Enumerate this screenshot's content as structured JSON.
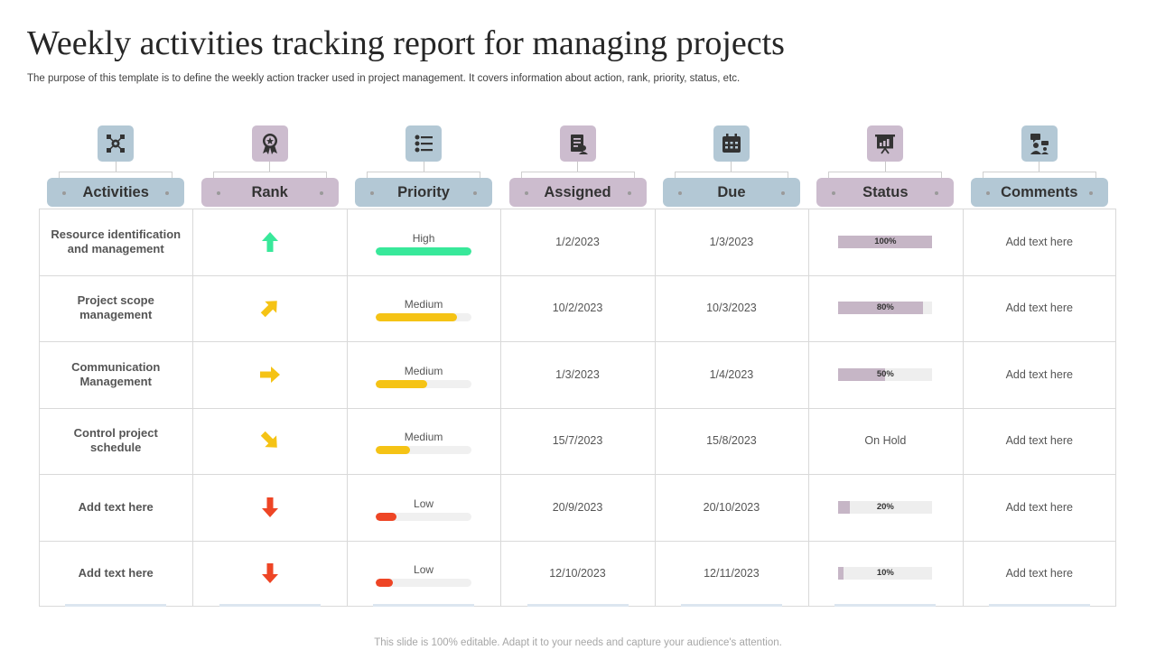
{
  "title": "Weekly activities tracking report for managing projects",
  "subtitle": "The purpose of this template is to define the weekly action tracker used in project management. It covers information about action, rank, priority, status, etc.",
  "footer": "This slide is 100% editable. Adapt it to your needs and capture your audience's attention.",
  "colors": {
    "blue_header": "#b3c8d5",
    "mauve_header": "#ccbcce",
    "high": "#38e89a",
    "medium": "#f5c315",
    "low": "#ee4525",
    "status_fill": "#c6b6c6"
  },
  "headers": [
    {
      "label": "Activities",
      "icon": "network-gear-icon"
    },
    {
      "label": "Rank",
      "icon": "award-badge-icon"
    },
    {
      "label": "Priority",
      "icon": "priority-list-icon"
    },
    {
      "label": "Assigned",
      "icon": "assigned-document-icon"
    },
    {
      "label": "Due",
      "icon": "calendar-icon"
    },
    {
      "label": "Status",
      "icon": "presentation-board-icon"
    },
    {
      "label": "Comments",
      "icon": "team-chat-icon"
    }
  ],
  "rows": [
    {
      "activity": "Resource identification and management",
      "rank": "up",
      "priority": "High",
      "priority_level": 1.0,
      "assigned": "1/2/2023",
      "due": "1/3/2023",
      "status": "100%",
      "status_value": 1.0,
      "comment": "Add text here"
    },
    {
      "activity": "Project scope management",
      "rank": "up-right",
      "priority": "Medium",
      "priority_level": 0.85,
      "assigned": "10/2/2023",
      "due": "10/3/2023",
      "status": "80%",
      "status_value": 0.9,
      "comment": "Add text here"
    },
    {
      "activity": "Communication Management",
      "rank": "right",
      "priority": "Medium",
      "priority_level": 0.54,
      "assigned": "1/3/2023",
      "due": "1/4/2023",
      "status": "50%",
      "status_value": 0.5,
      "comment": "Add text here"
    },
    {
      "activity": "Control project schedule",
      "rank": "down-right",
      "priority": "Medium",
      "priority_level": 0.36,
      "assigned": "15/7/2023",
      "due": "15/8/2023",
      "status": "On Hold",
      "status_value": null,
      "comment": "Add text here"
    },
    {
      "activity": "Add text here",
      "rank": "down",
      "priority": "Low",
      "priority_level": 0.22,
      "assigned": "20/9/2023",
      "due": "20/10/2023",
      "status": "20%",
      "status_value": 0.12,
      "comment": "Add text here"
    },
    {
      "activity": "Add text here",
      "rank": "down",
      "priority": "Low",
      "priority_level": 0.18,
      "assigned": "12/10/2023",
      "due": "12/11/2023",
      "status": "10%",
      "status_value": 0.05,
      "comment": "Add text here"
    }
  ]
}
